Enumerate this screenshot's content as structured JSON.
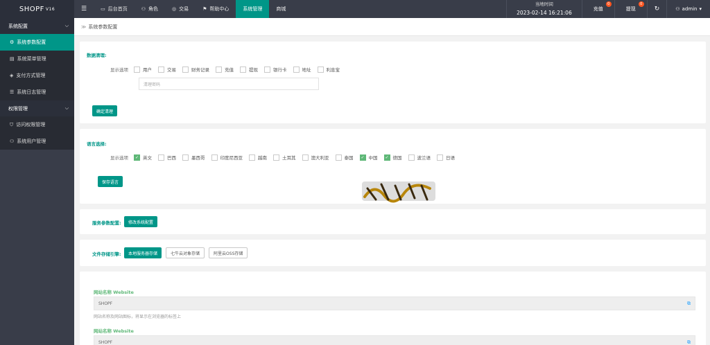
{
  "app": {
    "name": "SHOPF",
    "version": "V16"
  },
  "topnav": [
    {
      "label": "后台首页",
      "icon": "monitor-icon"
    },
    {
      "label": "角色",
      "icon": "user-icon"
    },
    {
      "label": "交易",
      "icon": "bag-icon"
    },
    {
      "label": "帮助中心",
      "icon": "flag-icon"
    },
    {
      "label": "系统管理",
      "active": true
    },
    {
      "label": "商城"
    }
  ],
  "header_right": {
    "time_label": "当地时间",
    "time_value": "2023-02-14 16:21:06",
    "recharge_label": "充值",
    "recharge_badge": "0",
    "withdraw_label": "提现",
    "withdraw_badge": "0",
    "user": "admin"
  },
  "sidebar": {
    "group1": "系统配置",
    "items1": [
      {
        "label": "系统参数配置",
        "icon": "gear-icon",
        "active": true
      },
      {
        "label": "系统菜单管理",
        "icon": "menu-icon"
      },
      {
        "label": "支付方式管理",
        "icon": "payment-icon"
      },
      {
        "label": "系统日志管理",
        "icon": "log-icon"
      }
    ],
    "group2": "权限管理",
    "items2": [
      {
        "label": "访问权限管理",
        "icon": "shield-icon"
      },
      {
        "label": "系统用户管理",
        "icon": "user-icon"
      }
    ]
  },
  "breadcrumb": "系统参数配置",
  "data_section": {
    "legend": "数据清理:",
    "row_label": "显示选项",
    "options": [
      {
        "label": "用户",
        "checked": false
      },
      {
        "label": "交易",
        "checked": false
      },
      {
        "label": "财务记录",
        "checked": false
      },
      {
        "label": "充值",
        "checked": false
      },
      {
        "label": "提现",
        "checked": false
      },
      {
        "label": "银行卡",
        "checked": false
      },
      {
        "label": "地址",
        "checked": false
      },
      {
        "label": "利息宝",
        "checked": false
      }
    ],
    "password_placeholder": "清理密码",
    "button": "确定清理"
  },
  "lang_section": {
    "legend": "语言选择:",
    "row_label": "显示选项",
    "options": [
      {
        "label": "英文",
        "checked": true
      },
      {
        "label": "巴西",
        "checked": false
      },
      {
        "label": "墨西哥",
        "checked": false
      },
      {
        "label": "印度尼西亚",
        "checked": false
      },
      {
        "label": "越南",
        "checked": false
      },
      {
        "label": "土耳其",
        "checked": false
      },
      {
        "label": "澳大利亚",
        "checked": false
      },
      {
        "label": "泰国",
        "checked": false
      },
      {
        "label": "中国",
        "checked": true
      },
      {
        "label": "德国",
        "checked": true
      },
      {
        "label": "波兰语",
        "checked": false
      },
      {
        "label": "日语",
        "checked": false
      }
    ],
    "button": "保存语言"
  },
  "service_section": {
    "legend": "服务参数配置:",
    "button": "修改系统配置"
  },
  "storage_section": {
    "legend": "文件存储引擎:",
    "buttons": [
      {
        "label": "本地服务器存储",
        "active": true
      },
      {
        "label": "七牛云对象存储",
        "active": false
      },
      {
        "label": "阿里云OSS存储",
        "active": false
      }
    ]
  },
  "site_section": {
    "label1": "网站名称 Website",
    "value1": "SHOPF",
    "help1": "网站名称及网站图标，将显示在浏览器的标签上",
    "label2": "网站名称 Website",
    "value2": "SHOPF"
  },
  "colors": {
    "accent": "#009688",
    "topbar": "#393d49",
    "sidebar": "#2b2f3a",
    "checked": "#5fb878"
  }
}
